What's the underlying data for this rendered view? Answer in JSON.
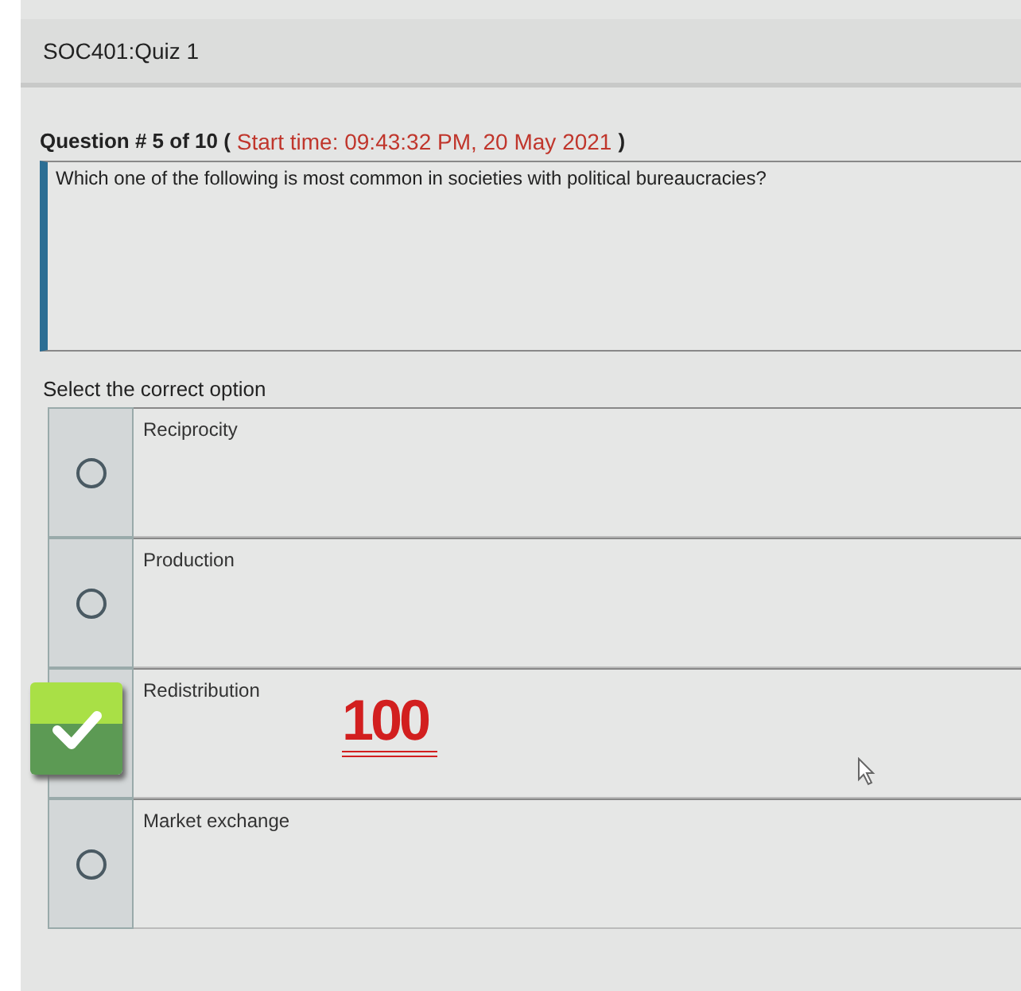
{
  "quiz_title": "SOC401:Quiz 1",
  "question_header": {
    "number": "Question # 5 of 10 (",
    "start_time": "Start time: 09:43:32 PM, 20 May 2021",
    "close": ")"
  },
  "question_text": "Which one of the following is most common in societies with political bureaucracies?",
  "prompt": "Select the correct option",
  "options": [
    {
      "label": "Reciprocity",
      "selected": false
    },
    {
      "label": "Production",
      "selected": false
    },
    {
      "label": "Redistribution",
      "selected": true
    },
    {
      "label": "Market exchange",
      "selected": false
    }
  ],
  "sticker": "100"
}
